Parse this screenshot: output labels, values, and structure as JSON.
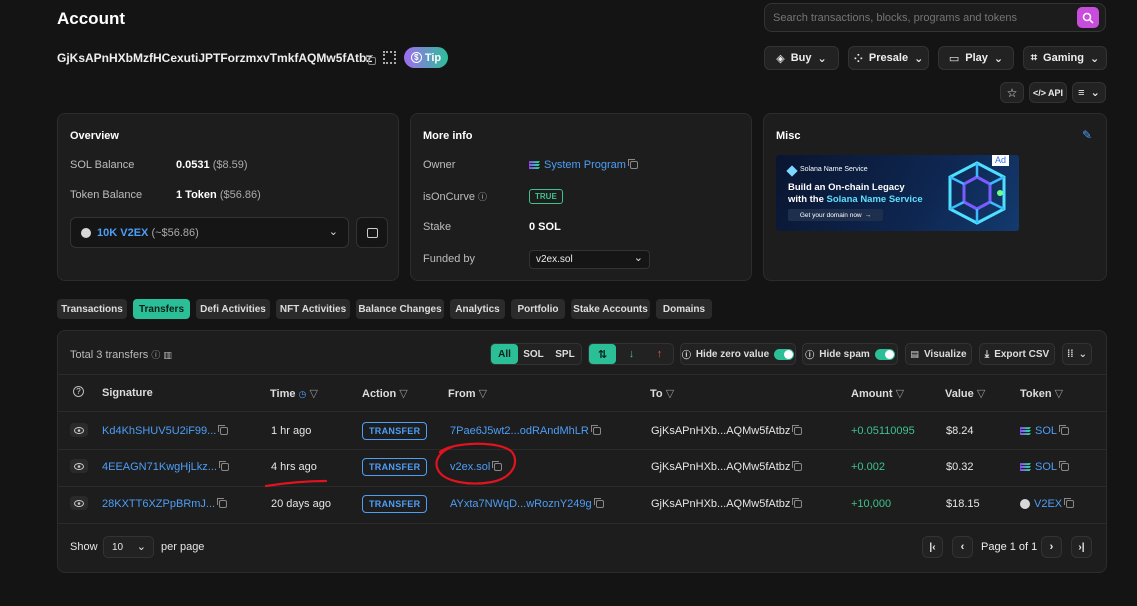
{
  "page": {
    "title": "Account",
    "address": "GjKsAPnHXbMzfHCexutiJPTForzmxvTmkfAQMw5fAtbz",
    "tip_label": "Tip"
  },
  "search": {
    "placeholder": "Search transactions, blocks, programs and tokens"
  },
  "topnav": {
    "buy": "Buy",
    "presale": "Presale",
    "play": "Play",
    "gaming": "Gaming",
    "api": "API"
  },
  "overview": {
    "title": "Overview",
    "sol_balance_label": "SOL Balance",
    "sol_balance_value": "0.0531",
    "sol_balance_usd": "($8.59)",
    "token_balance_label": "Token Balance",
    "token_balance_value": "1 Token",
    "token_balance_usd": "($56.86)",
    "token_select": "10K V2EX",
    "token_select_usd": "(~$56.86)"
  },
  "moreinfo": {
    "title": "More info",
    "owner_label": "Owner",
    "owner_value": "System Program",
    "oncurve_label": "isOnCurve",
    "oncurve_value": "TRUE",
    "stake_label": "Stake",
    "stake_value": "0 SOL",
    "funded_label": "Funded by",
    "funded_value": "v2ex.sol"
  },
  "misc": {
    "title": "Misc",
    "ad_badge": "Ad",
    "ad_brand": "Solana Name Service",
    "ad_line1": "Build an On-chain Legacy",
    "ad_line2_prefix": "with the ",
    "ad_line2_highlight": "Solana Name Service",
    "ad_cta": "Get your domain now"
  },
  "tabs": [
    "Transactions",
    "Transfers",
    "Defi Activities",
    "NFT Activities",
    "Balance Changes",
    "Analytics",
    "Portfolio",
    "Stake Accounts",
    "Domains"
  ],
  "transfers": {
    "total": "Total 3 transfers",
    "filters": {
      "all": "All",
      "sol": "SOL",
      "spl": "SPL",
      "hide_zero": "Hide zero value",
      "hide_spam": "Hide spam",
      "visualize": "Visualize",
      "export": "Export CSV"
    },
    "headers": {
      "signature": "Signature",
      "time": "Time",
      "action": "Action",
      "from": "From",
      "to": "To",
      "amount": "Amount",
      "value": "Value",
      "token": "Token"
    },
    "rows": [
      {
        "signature": "Kd4KhSHUV5U2iF99...",
        "time": "1 hr ago",
        "action": "TRANSFER",
        "from": "7Pae6J5wt2...odRAndMhLR",
        "to": "GjKsAPnHXb...AQMw5fAtbz",
        "amount": "+0.05110095",
        "value": "$8.24",
        "token": "SOL"
      },
      {
        "signature": "4EEAGN71KwgHjLkz...",
        "time": "4 hrs ago",
        "action": "TRANSFER",
        "from": "v2ex.sol",
        "to": "GjKsAPnHXb...AQMw5fAtbz",
        "amount": "+0.002",
        "value": "$0.32",
        "token": "SOL"
      },
      {
        "signature": "28KXTT6XZPpBRmJ...",
        "time": "20 days ago",
        "action": "TRANSFER",
        "from": "AYxta7NWqD...wRoznY249g",
        "to": "GjKsAPnHXb...AQMw5fAtbz",
        "amount": "+10,000",
        "value": "$18.15",
        "token": "V2EX"
      }
    ],
    "footer": {
      "show": "Show",
      "page_size": "10",
      "per_page": "per page",
      "page_info": "Page 1 of 1"
    }
  },
  "colors": {
    "accent": "#2bbf98",
    "link": "#4d9ef7",
    "annotation": "#e0131f"
  }
}
